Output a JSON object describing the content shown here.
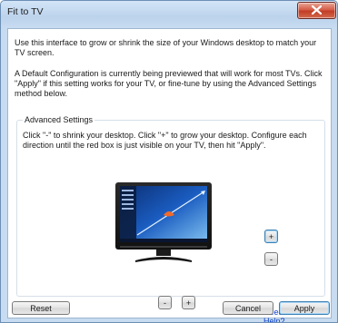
{
  "window": {
    "title": "Fit to TV",
    "close_icon": "close-icon"
  },
  "intro": {
    "paragraph1": "Use this interface to grow or shrink the size of your Windows desktop to match your TV screen.",
    "paragraph2": "A Default Configuration is currently being previewed that will work for most TVs. Click \"Apply\" if this setting works for your TV, or fine-tune by using the Advanced Settings method below."
  },
  "advanced": {
    "legend": "Advanced Settings",
    "instructions": "Click \"-\" to shrink  your desktop. Click \"+\" to grow your desktop. Configure each direction until the red box is just visible on your TV, then hit \"Apply\".",
    "vertical_plus": "+",
    "vertical_minus": "-",
    "horizontal_minus": "-",
    "horizontal_plus": "+",
    "help_link": "Need More Help?"
  },
  "footer": {
    "reset": "Reset",
    "cancel": "Cancel",
    "apply": "Apply"
  },
  "colors": {
    "window_border": "#6d8fb5",
    "close_button": "#c9462c",
    "link": "#0a3fc9",
    "focus_blue": "#3c7fb1"
  }
}
